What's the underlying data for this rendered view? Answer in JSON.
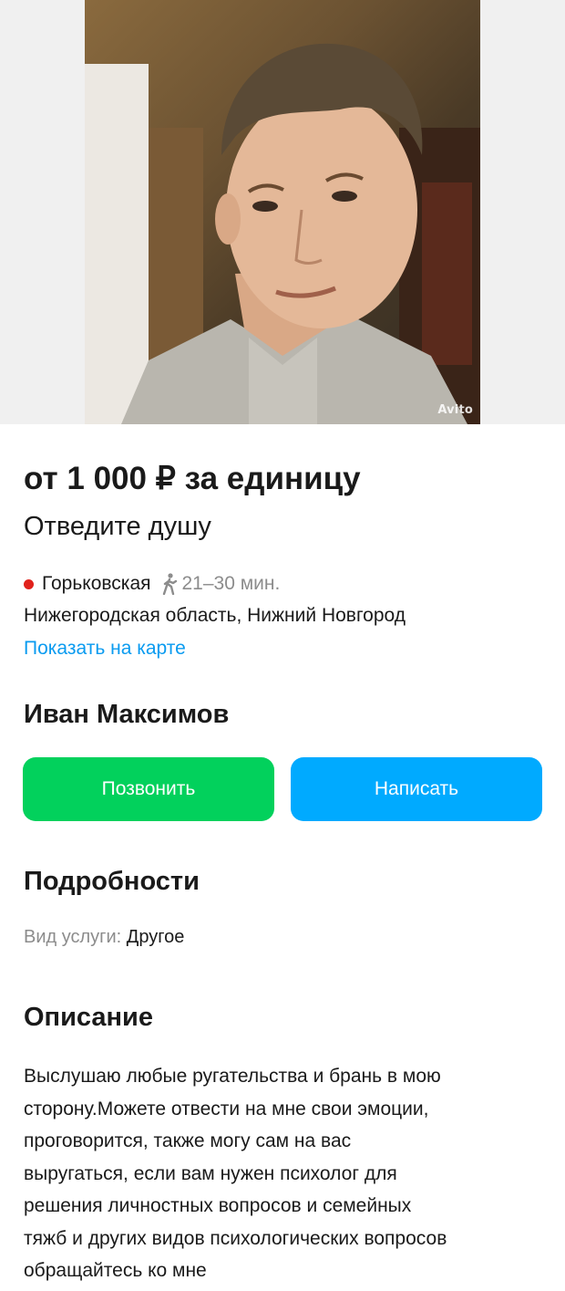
{
  "listing": {
    "price": "от 1 000 ₽ за единицу",
    "title": "Отведите душу",
    "photo_watermark": "Avito"
  },
  "location": {
    "metro_station": "Горьковская",
    "metro_color": "#e1221c",
    "walk_time": "21–30 мин.",
    "address": "Нижегородская область, Нижний Новгород",
    "map_link": "Показать на карте"
  },
  "seller": {
    "name": "Иван Максимов"
  },
  "actions": {
    "call_label": "Позвонить",
    "call_color": "#02d15c",
    "write_label": "Написать",
    "write_color": "#00aaff"
  },
  "details": {
    "heading": "Подробности",
    "params": [
      {
        "label": "Вид услуги:",
        "value": "Другое"
      }
    ]
  },
  "description": {
    "heading": "Описание",
    "lines": [
      "Выслушаю любые ругательства и брань в мою",
      "сторону.Можете отвести на мне свои эмоции,",
      "проговорится, также могу сам на вас",
      "выругаться, если вам нужен психолог для",
      "решения личностных вопросов и семейных",
      "тяжб и других видов психологических вопросов",
      "обращайтесь ко мне"
    ]
  },
  "icons": {
    "walk": "walking-person-icon",
    "metro": "metro-dot-icon"
  }
}
